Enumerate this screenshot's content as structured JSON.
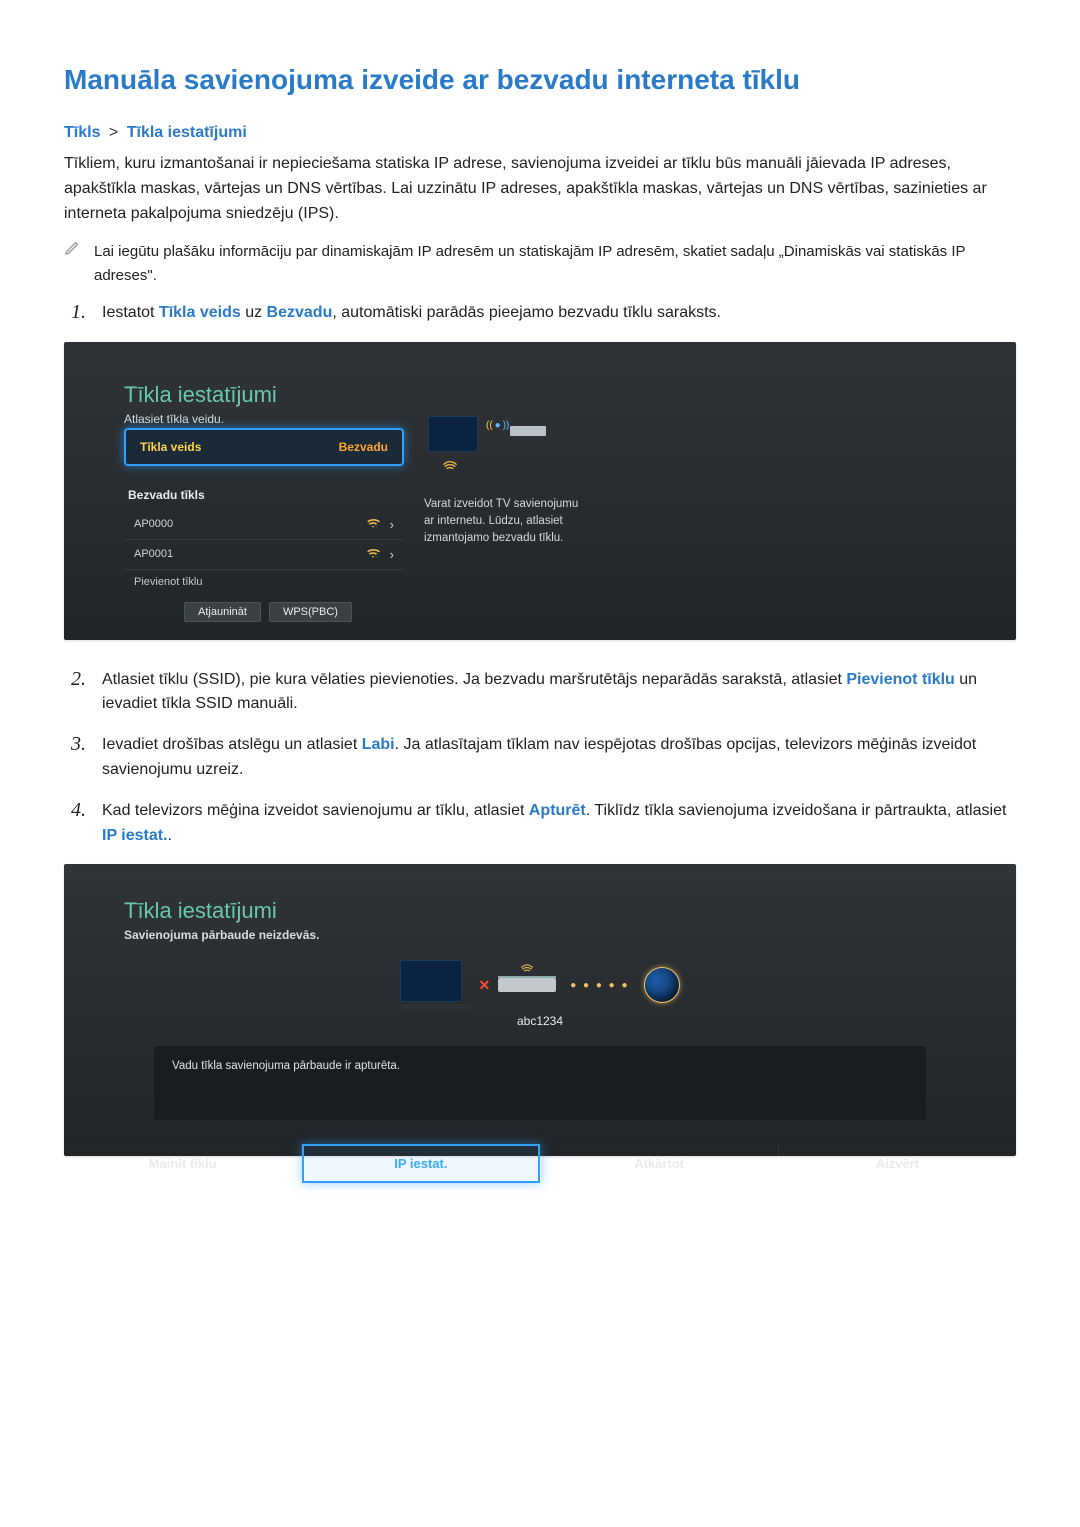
{
  "title": "Manuāla savienojuma izveide ar bezvadu interneta tīklu",
  "breadcrumb": {
    "a": "Tīkls",
    "sep": ">",
    "b": "Tīkla iestatījumi"
  },
  "intro": "Tīkliem, kuru izmantošanai ir nepieciešama statiska IP adrese, savienojuma izveidei ar tīklu būs manuāli jāievada IP adreses, apakštīkla maskas, vārtejas un DNS vērtības. Lai uzzinātu IP adreses, apakštīkla maskas, vārtejas un DNS vērtības, sazinieties ar interneta pakalpojuma sniedzēju (IPS).",
  "note": "Lai iegūtu plašāku informāciju par dinamiskajām IP adresēm un statiskajām IP adresēm, skatiet sadaļu „Dinamiskās vai statiskās IP adreses\".",
  "steps": {
    "s1a": "Iestatot ",
    "s1term1": "Tīkla veids",
    "s1b": " uz ",
    "s1term2": "Bezvadu",
    "s1c": ", automātiski parādās pieejamo bezvadu tīklu saraksts.",
    "s2a": "Atlasiet tīklu (SSID), pie kura vēlaties pievienoties. Ja bezvadu maršrutētājs neparādās sarakstā, atlasiet ",
    "s2term": "Pievienot tīklu",
    "s2b": " un ievadiet tīkla SSID manuāli.",
    "s3a": "Ievadiet drošības atslēgu un atlasiet ",
    "s3term": "Labi",
    "s3b": ". Ja atlasītajam tīklam nav iespējotas drošības opcijas, televizors mēģinās izveidot savienojumu uzreiz.",
    "s4a": "Kad televizors mēģina izveidot savienojumu ar tīklu, atlasiet ",
    "s4term1": "Apturēt",
    "s4b": ". Tiklīdz tīkla savienojuma izveidošana ir pārtraukta, atlasiet ",
    "s4term2": "IP iestat.",
    "s4c": "."
  },
  "shot1": {
    "title": "Tīkla iestatījumi",
    "sub": "Atlasiet tīkla veidu.",
    "field_label": "Tīkla veids",
    "field_value": "Bezvadu",
    "net_head": "Bezvadu tīkls",
    "rows": [
      "AP0000",
      "AP0001"
    ],
    "add": "Pievienot tīklu",
    "btn_refresh": "Atjaunināt",
    "btn_wps": "WPS(PBC)",
    "right1": "Varat izveidot TV savienojumu",
    "right2": "ar internetu. Lūdzu, atlasiet",
    "right3": "izmantojamo bezvadu tīklu."
  },
  "shot2": {
    "title": "Tīkla iestatījumi",
    "sub": "Savienojuma pārbaude neizdevās.",
    "ssid": "abc1234",
    "msg": "Vadu tīkla savienojuma pārbaude ir apturēta.",
    "btns": [
      "Mainīt tīklu",
      "IP iestat.",
      "Atkārtot",
      "Aizvērt"
    ]
  }
}
